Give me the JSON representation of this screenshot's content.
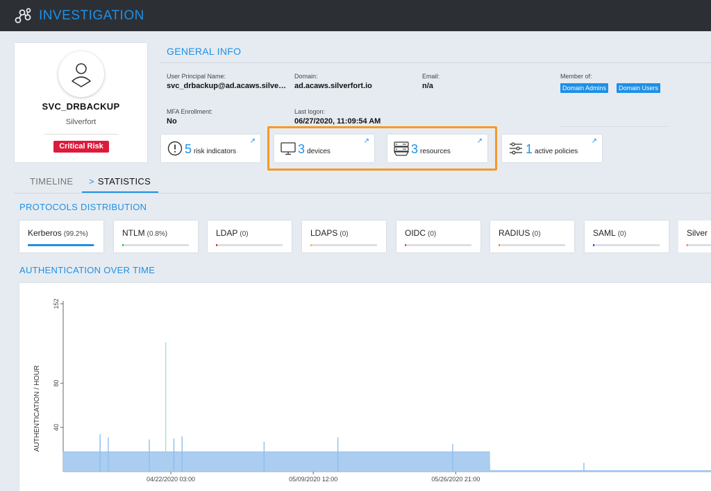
{
  "app": {
    "title": "INVESTIGATION"
  },
  "user": {
    "name": "SVC_DRBACKUP",
    "org": "Silverfort",
    "risk": "Critical Risk"
  },
  "general_info": {
    "title": "GENERAL INFO",
    "upn_label": "User Principal Name:",
    "upn_value": "svc_drbackup@ad.acaws.silve…",
    "domain_label": "Domain:",
    "domain_value": "ad.acaws.silverfort.io",
    "email_label": "Email:",
    "email_value": "n/a",
    "member_label": "Member of:",
    "member_groups": [
      "Domain Admins",
      "Domain Users"
    ],
    "mfa_label": "MFA Enrollment:",
    "mfa_value": "No",
    "logon_label": "Last logon:",
    "logon_value": "06/27/2020, 11:09:54 AM"
  },
  "indicators": [
    {
      "icon": "exclamation-circle-icon",
      "count": "5",
      "label": "risk indicators"
    },
    {
      "icon": "monitor-icon",
      "count": "3",
      "label": "devices"
    },
    {
      "icon": "server-icon",
      "count": "3",
      "label": "resources"
    },
    {
      "icon": "sliders-icon",
      "count": "1",
      "label": "active policies"
    }
  ],
  "tabs": {
    "timeline": "TIMELINE",
    "statistics": "STATISTICS",
    "chevron": ">"
  },
  "sections": {
    "protocols": "PROTOCOLS DISTRIBUTION",
    "auth": "AUTHENTICATION OVER TIME"
  },
  "protocols": [
    {
      "name": "Kerberos",
      "pct": "(99.2%)",
      "fraction": 0.992,
      "color": "#1e90e6"
    },
    {
      "name": "NTLM",
      "pct": "(0.8%)",
      "fraction": 0.008,
      "color": "#27c27b"
    },
    {
      "name": "LDAP",
      "pct": "(0)",
      "fraction": 0,
      "color": "#e5333f"
    },
    {
      "name": "LDAPS",
      "pct": "(0)",
      "fraction": 0,
      "color": "#f3c12b"
    },
    {
      "name": "OIDC",
      "pct": "(0)",
      "fraction": 0,
      "color": "#c941d6"
    },
    {
      "name": "RADIUS",
      "pct": "(0)",
      "fraction": 0,
      "color": "#f08b2a"
    },
    {
      "name": "SAML",
      "pct": "(0)",
      "fraction": 0,
      "color": "#3b4bd6"
    },
    {
      "name": "Silver",
      "pct": "",
      "fraction": 0,
      "color": "#e5333f"
    }
  ],
  "colors": {
    "accent": "#1e90e6",
    "critical": "#dc1b3c",
    "highlight": "#f89826",
    "area": "#aacdf0"
  },
  "chart_data": {
    "type": "area",
    "title": "",
    "xlabel": "",
    "ylabel": "AUTHENTICATION / HOUR",
    "ylim": [
      0,
      152
    ],
    "yticks": [
      40,
      80,
      152
    ],
    "xticks": [
      "04/22/2020 03:00",
      "05/09/2020 12:00",
      "05/26/2020 21:00"
    ],
    "series": [
      {
        "points": [
          {
            "x": "04/09/2020 00:00",
            "y": 18
          },
          {
            "x": "05/31/2020 00:00",
            "y": 18
          },
          {
            "x": "05/31/2020 01:00",
            "y": 1
          },
          {
            "x": "06/27/2020 00:00",
            "y": 1
          }
        ]
      }
    ],
    "spikes": [
      {
        "x": "04/13/2020",
        "y": 34
      },
      {
        "x": "04/13/2020",
        "y": 30
      },
      {
        "x": "04/14/2020",
        "y": 31
      },
      {
        "x": "04/19/2020",
        "y": 29
      },
      {
        "x": "04/21/2020",
        "y": 117
      },
      {
        "x": "04/22/2020",
        "y": 30
      },
      {
        "x": "04/23/2020",
        "y": 32
      },
      {
        "x": "05/03/2020",
        "y": 27
      },
      {
        "x": "05/12/2020",
        "y": 31
      },
      {
        "x": "05/26/2020",
        "y": 25
      },
      {
        "x": "06/11/2020",
        "y": 8
      }
    ]
  }
}
